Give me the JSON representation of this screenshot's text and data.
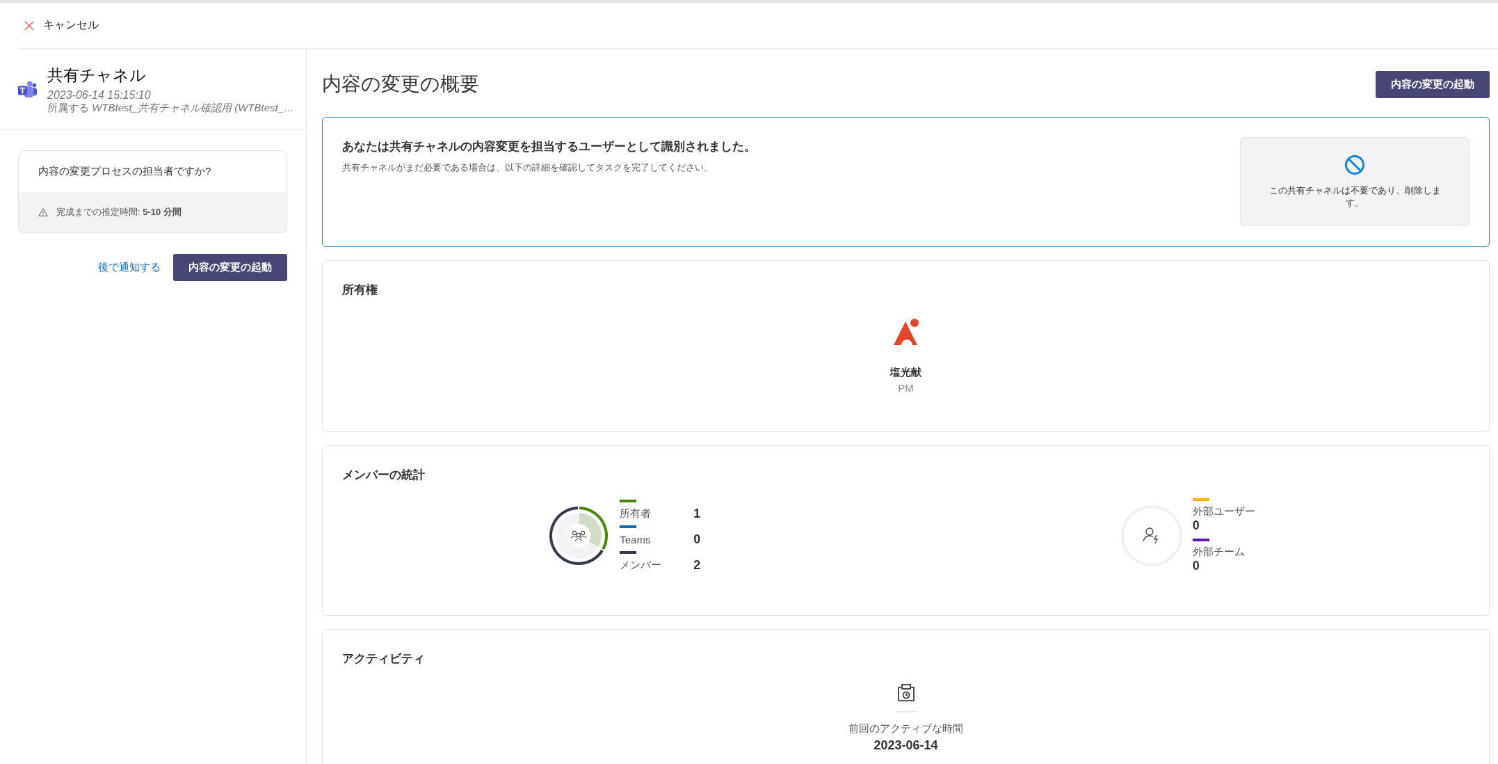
{
  "cancel": "キャンセル",
  "channel": {
    "title": "共有チャネル",
    "created": "2023-06-14 15:15:10",
    "team": "所属する *WTBtest_共有チャネル確認用 (WTBtest_…*"
  },
  "prompt": {
    "question": "内容の変更プロセスの担当者ですか?",
    "estimate": "完成までの推定時間: **5-10 分間**"
  },
  "left_actions": {
    "notify_later": "後で通知する",
    "start": "内容の変更の起動"
  },
  "summary": {
    "title": "内容の変更の概要",
    "start": "内容の変更の起動"
  },
  "banner": {
    "title": "あなたは共有チャネルの内容変更を担当するユーザーとして識別されました。",
    "description": "共有チャネルがまだ必要である場合は、以下の詳細を確認してタスクを完了してください。",
    "delete_option": "この共有チャネルは不要であり、削除します。"
  },
  "ownership": {
    "title": "所有権",
    "owner": {
      "name": "塩光献",
      "role": "PM"
    }
  },
  "members": {
    "title": "メンバーの統計",
    "legend": [
      {
        "label": "所有者",
        "value": "1",
        "color": "#498205"
      },
      {
        "label": "Teams",
        "value": "0",
        "color": "#0f6cbd"
      },
      {
        "label": "メンバー",
        "value": "2",
        "color": "#323a4b"
      }
    ],
    "external": [
      {
        "label": "外部ユーザー",
        "value": "0",
        "color": "#ffb900"
      },
      {
        "label": "外部チーム",
        "value": "0",
        "color": "#5c16c5"
      }
    ]
  },
  "activity": {
    "title": "アクティビティ",
    "last_active_label": "前回のアクティブな時間",
    "last_active_value": "2023-06-14"
  }
}
